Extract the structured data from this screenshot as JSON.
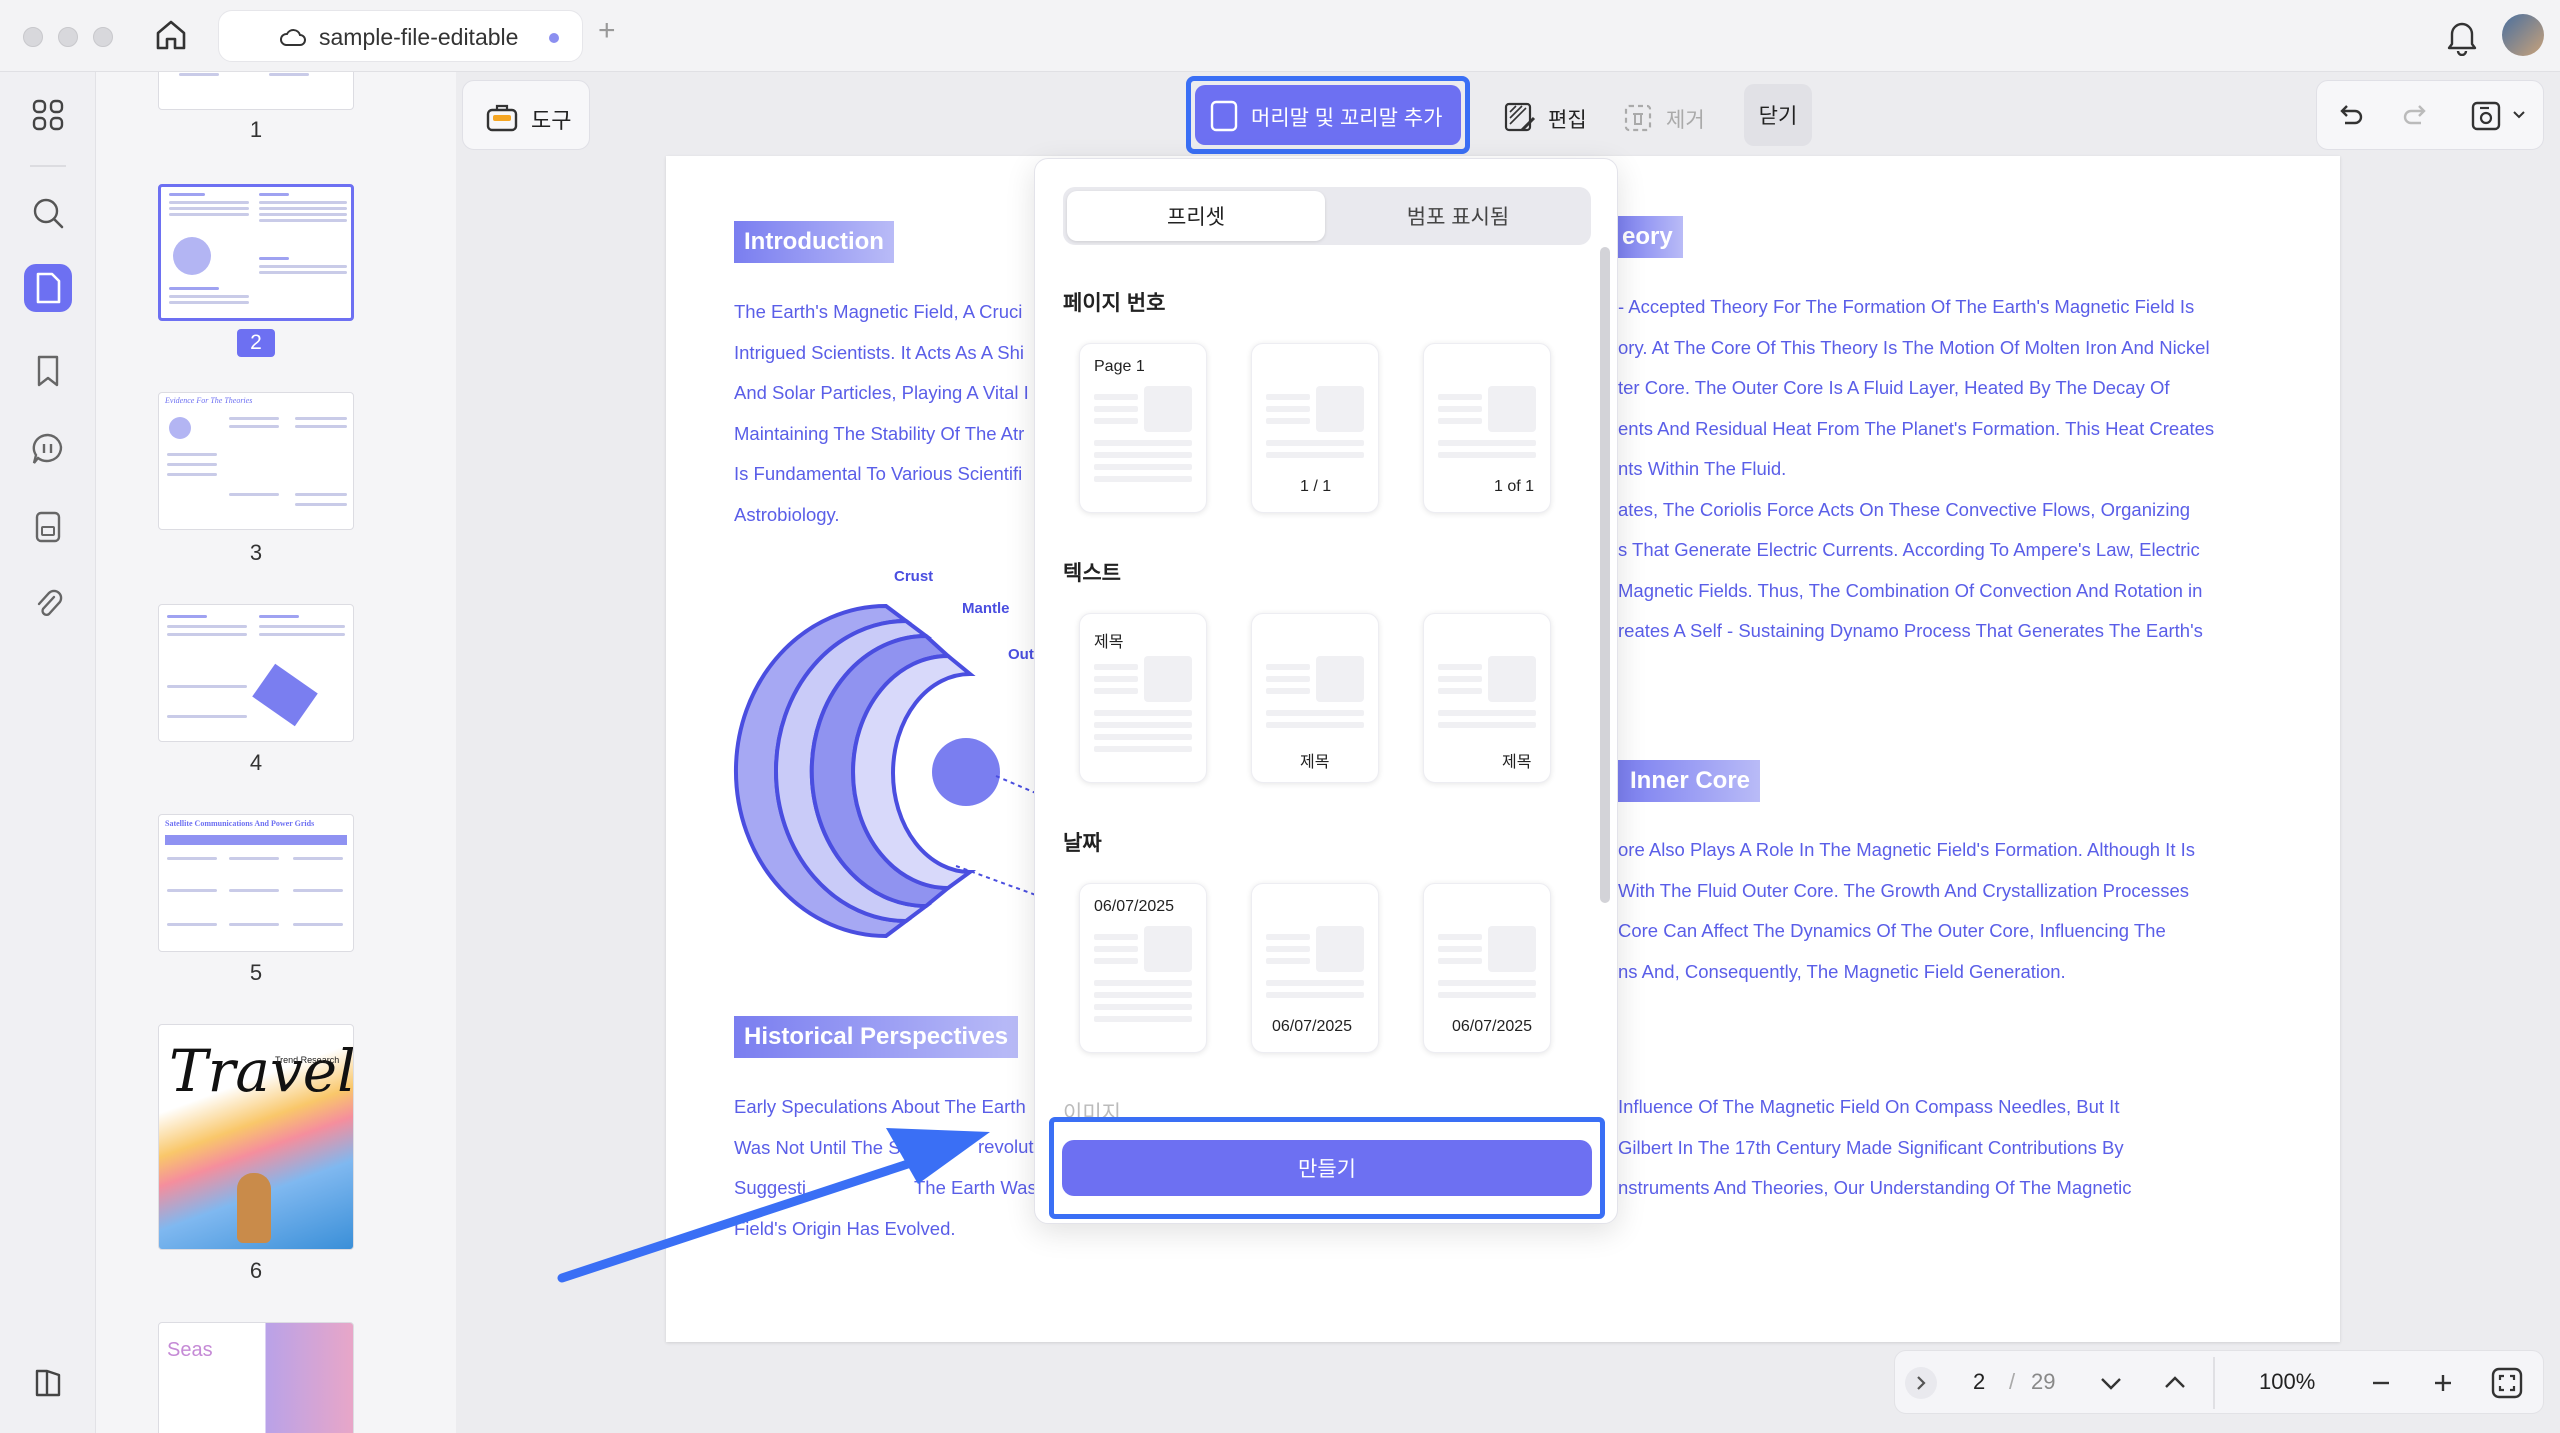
{
  "window": {
    "tab_title": "sample-file-editable",
    "new_tab": "+"
  },
  "toolbar": {
    "tools_label": "도구",
    "header_footer_label": "머리말 및 꼬리말 추가",
    "edit_label": "편집",
    "remove_label": "제거",
    "close_label": "닫기"
  },
  "thumbnails": [
    {
      "number": "1"
    },
    {
      "number": "2"
    },
    {
      "number": "3"
    },
    {
      "number": "4"
    },
    {
      "number": "5"
    },
    {
      "number": "6"
    }
  ],
  "thumb_text": {
    "t3_title": "Evidence For The Theories",
    "t5_title": "Satellite Communications And Power Grids",
    "t6_script": "Travel",
    "t6_sub": "Trend Research",
    "t7_word": "Seas"
  },
  "document": {
    "intro_heading": "Introduction",
    "intro_lines": [
      "The Earth's Magnetic Field, A Cruci",
      "Intrigued Scientists. It Acts As A Shi",
      "And Solar Particles, Playing A Vital I",
      "Maintaining The Stability Of The Atr",
      "Is Fundamental To Various Scientifi",
      "Astrobiology."
    ],
    "diagram_labels": [
      "Crust",
      "Mantle",
      "Out"
    ],
    "historical_heading": "Historical Perspectives",
    "historical_lines": [
      "Early Speculations About The Earth",
      "Was Not Until The Sci",
      "Suggesti",
      "Field's Origin Has Evolved."
    ],
    "historical_fragments": [
      "revolut",
      "The Earth Was A G"
    ],
    "theory_heading": "eory",
    "theory_lines": [
      "- Accepted Theory For The Formation Of The Earth's Magnetic Field Is",
      "ory. At The Core Of This Theory Is The Motion Of Molten Iron And Nickel",
      "ter Core. The Outer Core Is A Fluid Layer, Heated By The Decay Of",
      "ents And Residual Heat From The Planet's Formation. This Heat Creates",
      "nts Within The Fluid.",
      "ates, The Coriolis Force Acts On These Convective Flows, Organizing",
      "s That Generate Electric Currents. According To Ampere's Law, Electric",
      "Magnetic Fields. Thus, The Combination Of Convection And Rotation in",
      "reates A Self - Sustaining Dynamo Process That Generates The Earth's"
    ],
    "inner_heading": "Inner Core",
    "inner_lines": [
      "ore Also Plays A Role In The Magnetic Field's Formation. Although It Is",
      "With The Fluid Outer Core. The Growth And Crystallization Processes",
      "Core Can Affect The Dynamics Of The Outer Core, Influencing The",
      "ns And, Consequently, The Magnetic Field Generation."
    ],
    "right_bottom_lines": [
      "Influence Of The Magnetic Field On Compass Needles, But It",
      "Gilbert In The 17th Century Made Significant Contributions By",
      "nstruments And Theories, Our Understanding Of The Magnetic"
    ]
  },
  "popover": {
    "tab_presets": "프리셋",
    "tab_marked": "범포 표시됨",
    "group_page_number": "페이지 번호",
    "group_text": "텍스트",
    "group_date": "날짜",
    "group_image_partial": "이미지",
    "page_number_cards": [
      "Page 1",
      "1 / 1",
      "1 of 1"
    ],
    "text_cards": [
      "제목",
      "제목",
      "제목"
    ],
    "date_cards": [
      "06/07/2025",
      "06/07/2025",
      "06/07/2025"
    ],
    "create_label": "만들기"
  },
  "navigation": {
    "current_page": "2",
    "separator": "/",
    "total_pages": "29",
    "zoom": "100%"
  },
  "colors": {
    "accent": "#6d70f2",
    "highlight_border": "#3a6ff5",
    "doc_text": "#5a5ee8"
  }
}
